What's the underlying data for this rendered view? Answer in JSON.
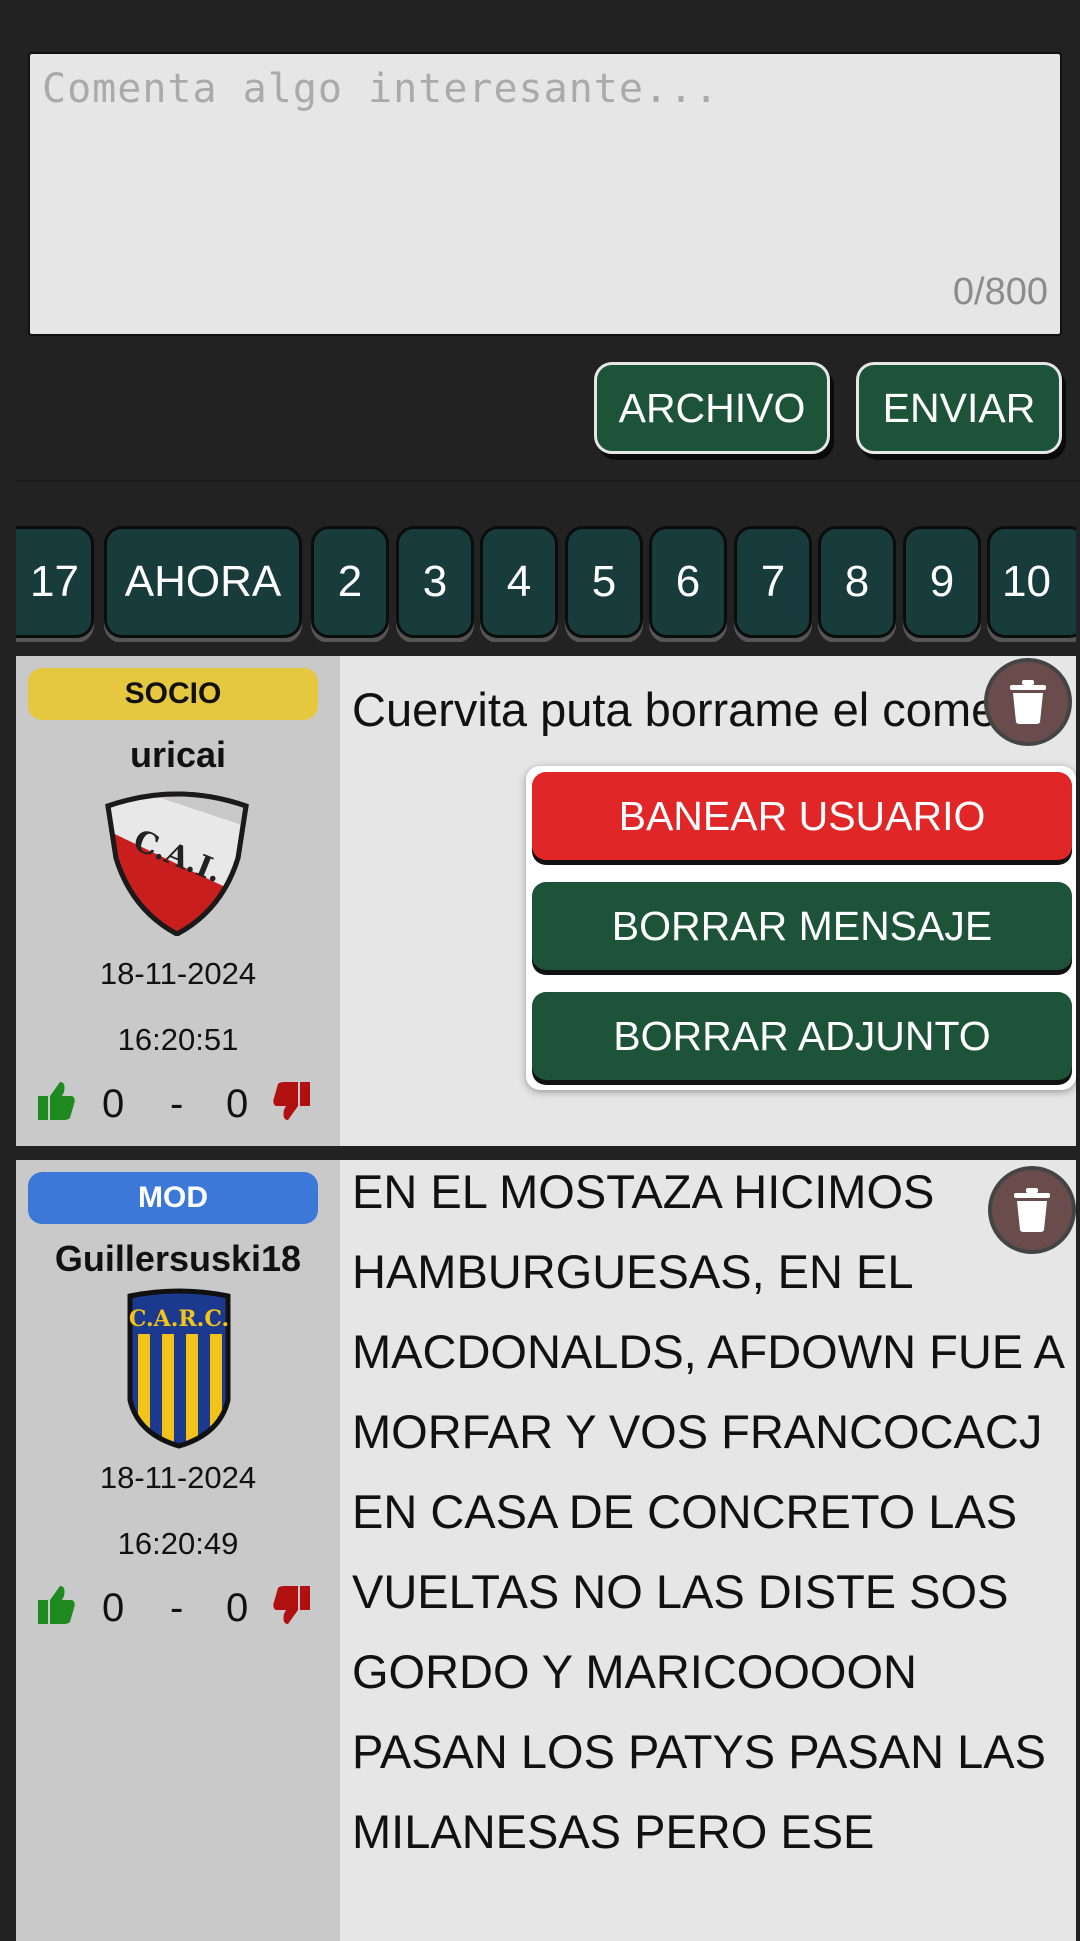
{
  "composer": {
    "placeholder": "Comenta algo interesante...",
    "counter": "0/800",
    "file_label": "ARCHIVO",
    "send_label": "ENVIAR"
  },
  "pagination": {
    "pages": [
      "17",
      "AHORA",
      "2",
      "3",
      "4",
      "5",
      "6",
      "7",
      "8",
      "9",
      "10"
    ]
  },
  "comments": [
    {
      "badge": "SOCIO",
      "badge_color": "#e6c840",
      "username": "uricai",
      "crest": "independiente-crest",
      "crest_text": "C.A.I.",
      "date": "18-11-2024",
      "time": "16:20:51",
      "likes": "0",
      "separator": "-",
      "dislikes": "0",
      "text": "Cuervita puta borrame el coment"
    },
    {
      "badge": "MOD",
      "badge_color": "#3c78d8",
      "username": "Guillersuski18",
      "crest": "rosario-central-crest",
      "crest_text": "C.A.R.C.",
      "date": "18-11-2024",
      "time": "16:20:49",
      "likes": "0",
      "separator": "-",
      "dislikes": "0",
      "text": "EN EL MOSTAZA HICIMOS HAMBURGUESAS, EN EL MACDONALDS, AFDOWN FUE A MORFAR Y VOS FRANCOCACJ EN CASA DE CONCRETO LAS VUELTAS NO LAS DISTE SOS GORDO Y MARICOOOON PASAN LOS PATYS PASAN LAS MILANESAS PERO ESE"
    }
  ],
  "mod_menu": {
    "ban_label": "BANEAR USUARIO",
    "delete_message_label": "BORRAR MENSAJE",
    "delete_attachment_label": "BORRAR ADJUNTO"
  },
  "colors": {
    "accent_green": "#1c5339",
    "danger_red": "#e02626",
    "page_button": "#183c3b",
    "vote_up": "#1f8a1f",
    "vote_down": "#b01010"
  }
}
